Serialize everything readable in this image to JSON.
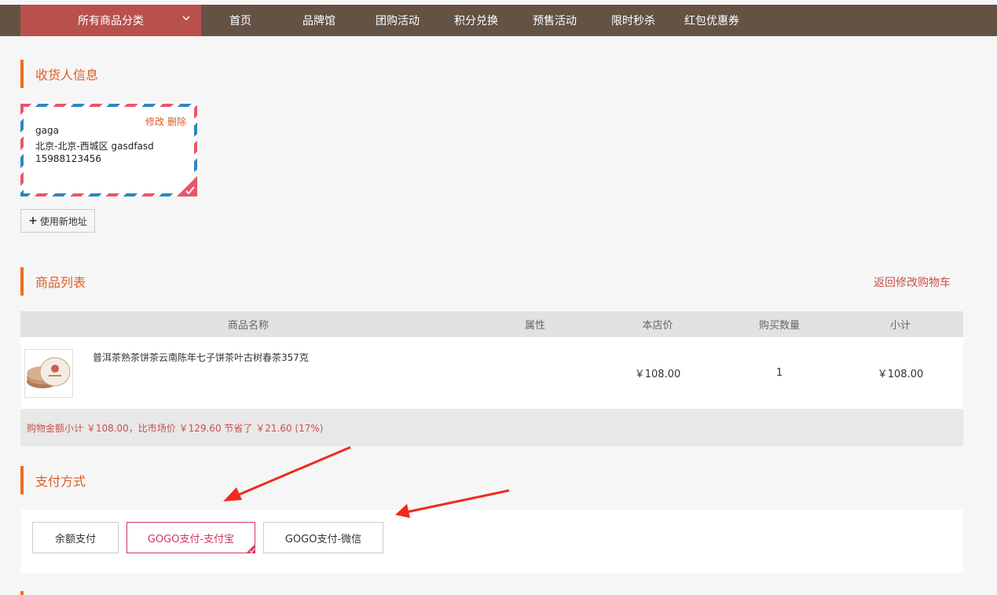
{
  "nav": {
    "category_label": "所有商品分类",
    "items": [
      "首页",
      "品牌馆",
      "团购活动",
      "积分兑换",
      "预售活动",
      "限时秒杀",
      "红包优惠券"
    ]
  },
  "receiver": {
    "title": "收货人信息",
    "card": {
      "edit": "修改",
      "delete": "删除",
      "name": "gaga",
      "address": "北京-北京-西城区 gasdfasd",
      "phone": "15988123456"
    },
    "new_address_label": "使用新地址"
  },
  "goods": {
    "title": "商品列表",
    "back_to_cart": "返回修改购物车",
    "columns": [
      "商品名称",
      "属性",
      "本店价",
      "购买数量",
      "小计"
    ],
    "rows": [
      {
        "name": "普洱茶熟茶饼茶云南陈年七子饼茶叶古树春茶357克",
        "attr": "",
        "price": "￥108.00",
        "qty": "1",
        "subtotal": "￥108.00"
      }
    ],
    "summary": "购物金额小计 ￥108.00，比市场价 ￥129.60 节省了 ￥21.60 (17%)"
  },
  "payment": {
    "title": "支付方式",
    "options": [
      "余额支付",
      "GOGO支付-支付宝",
      "GOGO支付-微信"
    ],
    "selected_index": 1
  },
  "colors": {
    "topbar": "#645245",
    "category": "#b8514c",
    "accent": "#f06d1d",
    "section_title": "#e05b22",
    "selected": "#d2385e",
    "annotation_arrow": "#f02a1e"
  }
}
